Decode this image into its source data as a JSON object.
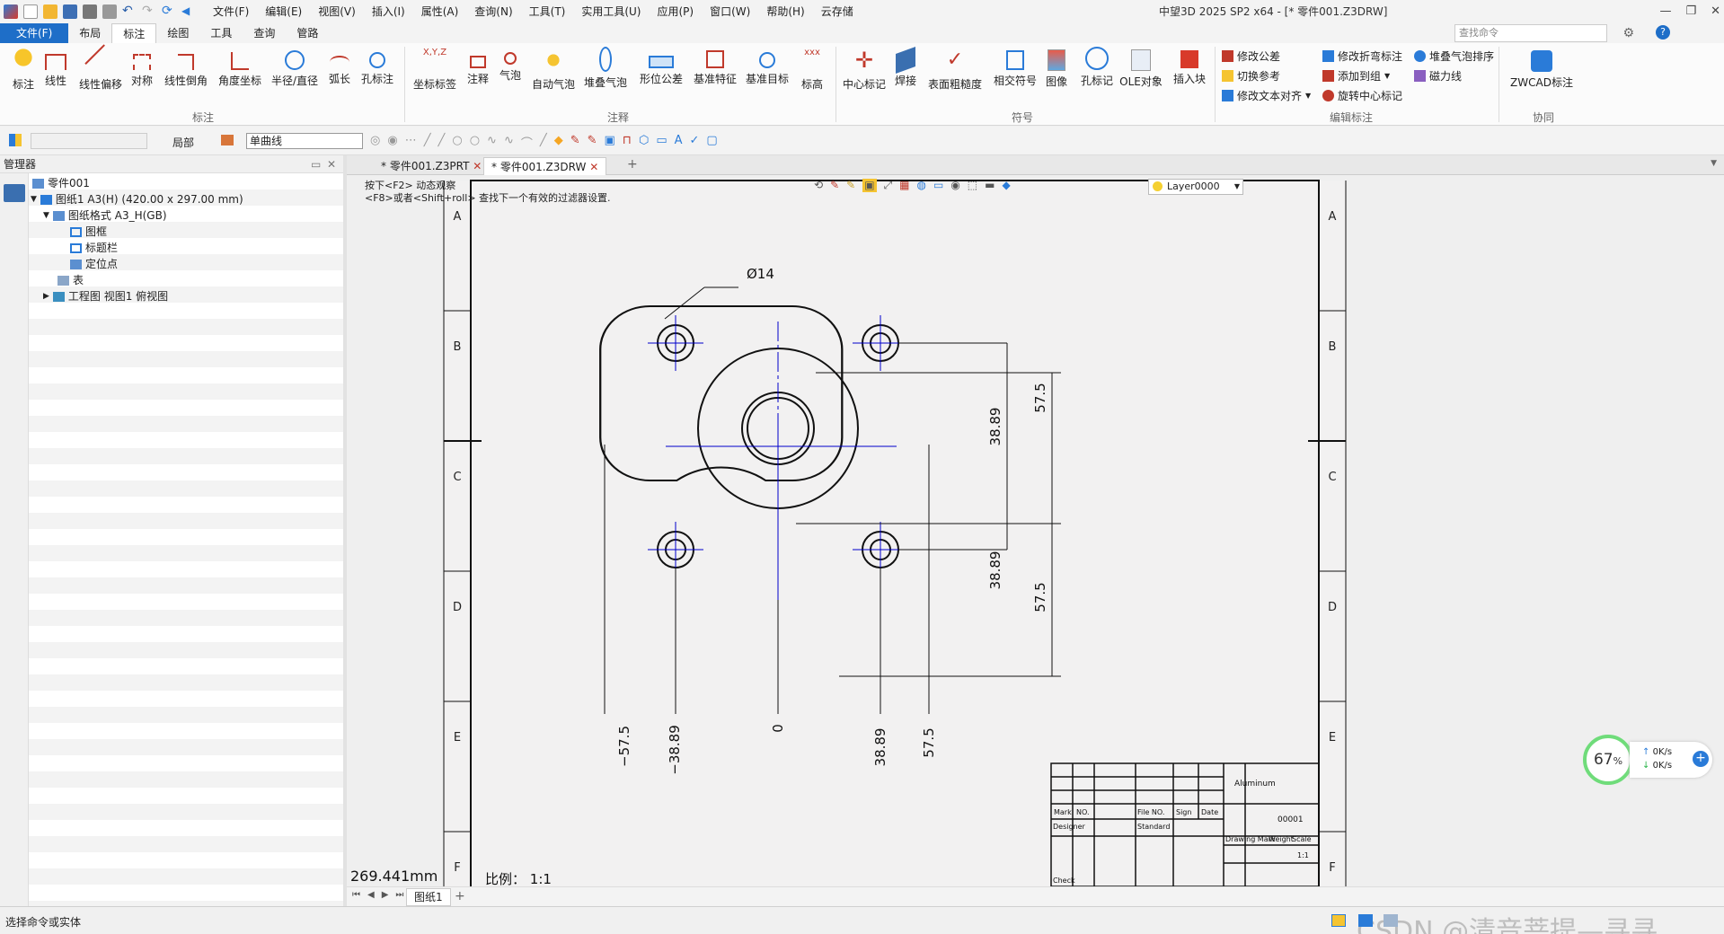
{
  "title_bar": {
    "window_title": "中望3D 2025 SP2 x64 - [* 零件001.Z3DRW]",
    "menu": [
      "文件(F)",
      "编辑(E)",
      "视图(V)",
      "插入(I)",
      "属性(A)",
      "查询(N)",
      "工具(T)",
      "实用工具(U)",
      "应用(P)",
      "窗口(W)",
      "帮助(H)",
      "云存储"
    ]
  },
  "ribbon_tabs": {
    "file": "文件(F)",
    "tabs": [
      "布局",
      "标注",
      "绘图",
      "工具",
      "查询",
      "管路"
    ],
    "active": "标注",
    "search_placeholder": "查找命令"
  },
  "ribbon": {
    "group_biaozhu": {
      "label": "标注",
      "buttons": [
        "标注",
        "线性",
        "线性偏移",
        "对称",
        "线性倒角",
        "角度坐标",
        "半径/直径",
        "弧长",
        "孔标注"
      ]
    },
    "group_zhushi": {
      "label": "注释",
      "buttons": [
        "坐标标签",
        "注释",
        "气泡",
        "自动气泡",
        "堆叠气泡",
        "形位公差",
        "基准特征",
        "基准目标",
        "标高"
      ]
    },
    "group_fuhao": {
      "label": "符号",
      "buttons": [
        "中心标记",
        "焊接",
        "表面粗糙度",
        "相交符号",
        "图像",
        "孔标记",
        "OLE对象",
        "插入块"
      ]
    },
    "group_edit": {
      "label": "编辑标注",
      "items": [
        "修改公差",
        "切换参考",
        "修改文本对齐",
        "修改折弯标注",
        "添加到组",
        "旋转中心标记",
        "堆叠气泡排序",
        "磁力线"
      ]
    },
    "group_xietong": {
      "label": "协同",
      "buttons": [
        "ZWCAD标注"
      ]
    }
  },
  "toolbar": {
    "local_label": "局部",
    "curve_combo": "单曲线"
  },
  "manager": {
    "title": "管理器",
    "tree": [
      {
        "label": "零件001"
      },
      {
        "label": "图纸1 A3(H) (420.00 x 297.00 mm)"
      },
      {
        "label": "图纸格式 A3_H(GB)"
      },
      {
        "label": "图框"
      },
      {
        "label": "标题栏"
      },
      {
        "label": "定位点"
      },
      {
        "label": "表"
      },
      {
        "label": "工程图 视图1 俯视图"
      }
    ]
  },
  "doc_tabs": {
    "tabs": [
      "* 零件001.Z3PRT",
      "* 零件001.Z3DRW"
    ],
    "active": "* 零件001.Z3DRW",
    "layer": "Layer0000"
  },
  "canvas": {
    "hint_line1": "按下<F2> 动态观察",
    "hint_line2": "<F8>或者<Shift+roll> 查找下一个有效的过滤器设置.",
    "cursor_length": "269.441mm",
    "scale_label": "比例：",
    "scale_value": "1:1",
    "zone_letters": [
      "A",
      "B",
      "C",
      "D",
      "E",
      "F"
    ],
    "dims": {
      "dia": "Ø14",
      "v_upper_inner": "38.89",
      "v_upper_outer": "57.5",
      "v_lower_inner": "38.89",
      "v_lower_outer": "57.5",
      "h_left_outer": "−57.5",
      "h_left_inner": "−38.89",
      "h_center": "0",
      "h_right_inner": "38.89",
      "h_right_outer": "57.5"
    },
    "title_block": {
      "material": "Aluminum",
      "drawing_no": "00001",
      "mark": "Mark",
      "no": "NO.",
      "file_no": "File NO.",
      "sign": "Sign",
      "date": "Date",
      "designer": "Designer",
      "standard": "Standard",
      "drawing_mark": "Drawing Mark",
      "weight": "Weight",
      "scale": "Scale",
      "scale_value": "1:1",
      "check": "Check"
    }
  },
  "sheet_tabs": {
    "active": "图纸1"
  },
  "status": {
    "text": "选择命令或实体",
    "watermark": "CSDN @清音菩提—寻寻"
  },
  "speed_widget": {
    "percent": "67",
    "unit": "%",
    "up": "0K/s",
    "down": "0K/s"
  },
  "colors": {
    "file_tab": "#1e6ec8",
    "centerline": "#0000cc",
    "speed_ring": "#6fdc7a"
  }
}
